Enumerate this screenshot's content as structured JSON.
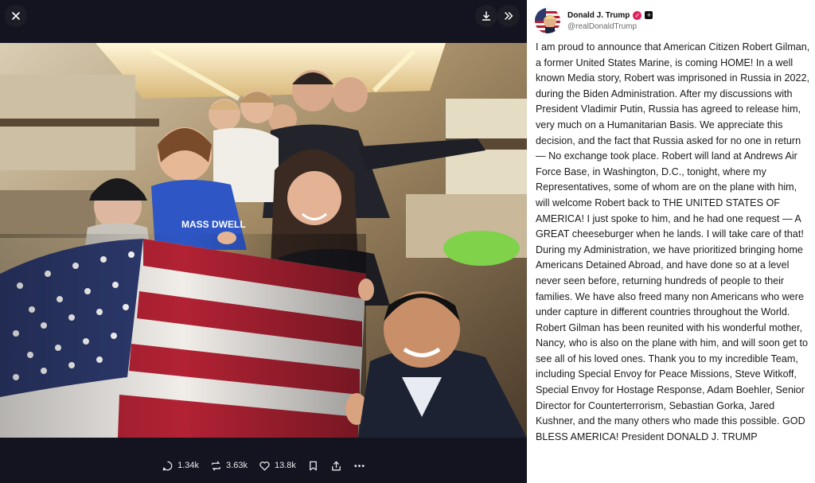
{
  "viewer": {
    "close_icon": "close-icon",
    "download_icon": "download-icon",
    "expand_icon": "double-chevron-right-icon",
    "photo_shirt_text": "MASS DWELL"
  },
  "actions": {
    "replies": "1.34k",
    "reposts": "3.63k",
    "likes": "13.8k"
  },
  "post": {
    "author_name": "Donald J. Trump",
    "author_handle": "@realDonaldTrump",
    "text": "I am proud to announce that American Citizen Robert Gilman, a former United States Marine, is coming HOME! In a well known Media story, Robert was imprisoned in Russia in 2022, during the Biden Administration. After my discussions with President Vladimir Putin, Russia has agreed to release him, very much on a Humanitarian Basis. We appreciate this decision, and the fact that Russia asked for no one in return — No exchange took place. Robert will land at Andrews Air Force Base, in Washington, D.C., tonight, where my Representatives, some of whom are on the plane with him, will welcome Robert back to THE UNITED STATES OF AMERICA! I just spoke to him, and he had one request — A GREAT cheeseburger when he lands. I will take care of that! During my Administration, we have prioritized bringing home Americans Detained Abroad, and have done so at a level never seen before, returning hundreds of people to their families. We have also freed many non Americans who were under capture in different countries throughout the World. Robert Gilman has been reunited with his wonderful mother, Nancy, who is also on the plane with him, and will soon get to see all of his loved ones. Thank you to my incredible Team, including Special Envoy for Peace Missions, Steve Witkoff, Special Envoy for Hostage Response, Adam Boehler, Senior Director for Counterterrorism, Sebastian Gorka, Jared Kushner, and the many others who made this possible. GOD BLESS AMERICA! President DONALD J. TRUMP"
  },
  "colors": {
    "viewer_bg": "#141420",
    "panel_bg": "#ffffff",
    "verified_badge": "#e0245e",
    "flag_red": "#b22234",
    "flag_blue": "#2d3a6e"
  }
}
